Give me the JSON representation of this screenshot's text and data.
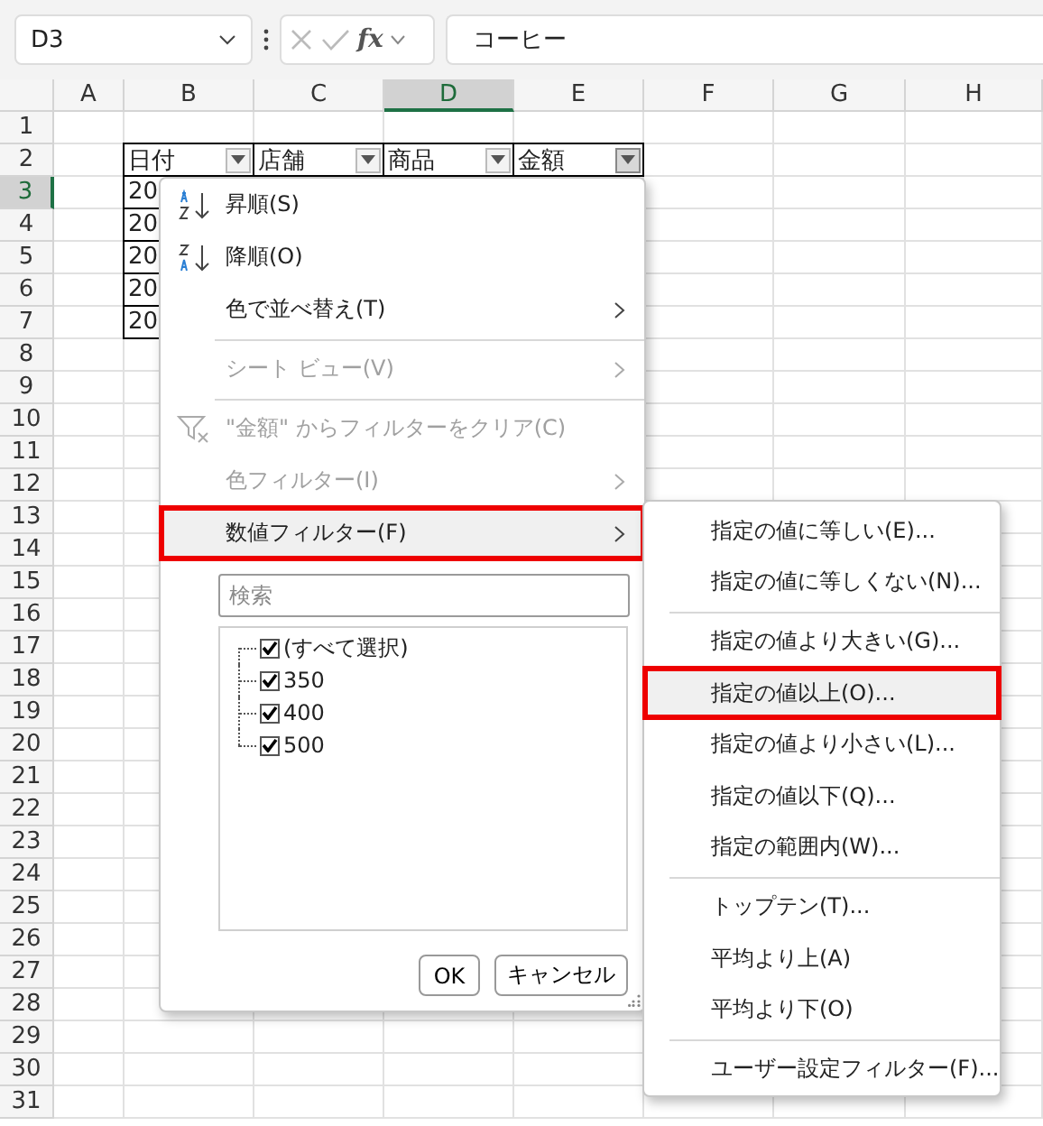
{
  "name_box": {
    "value": "D3"
  },
  "formula_bar": {
    "function_label": "fx",
    "value": "コーヒー"
  },
  "columns": [
    {
      "label": "A",
      "selected": false
    },
    {
      "label": "B",
      "selected": false
    },
    {
      "label": "C",
      "selected": false
    },
    {
      "label": "D",
      "selected": true
    },
    {
      "label": "E",
      "selected": false
    },
    {
      "label": "F",
      "selected": false
    },
    {
      "label": "G",
      "selected": false
    },
    {
      "label": "H",
      "selected": false
    }
  ],
  "rows": [
    {
      "label": "1",
      "selected": false
    },
    {
      "label": "2",
      "selected": false
    },
    {
      "label": "3",
      "selected": true
    },
    {
      "label": "4",
      "selected": false
    },
    {
      "label": "5",
      "selected": false
    },
    {
      "label": "6",
      "selected": false
    },
    {
      "label": "7",
      "selected": false
    },
    {
      "label": "8",
      "selected": false
    },
    {
      "label": "9",
      "selected": false
    },
    {
      "label": "10",
      "selected": false
    },
    {
      "label": "11",
      "selected": false
    },
    {
      "label": "12",
      "selected": false
    },
    {
      "label": "13",
      "selected": false
    },
    {
      "label": "14",
      "selected": false
    },
    {
      "label": "15",
      "selected": false
    },
    {
      "label": "16",
      "selected": false
    },
    {
      "label": "17",
      "selected": false
    },
    {
      "label": "18",
      "selected": false
    },
    {
      "label": "19",
      "selected": false
    },
    {
      "label": "20",
      "selected": false
    },
    {
      "label": "21",
      "selected": false
    },
    {
      "label": "22",
      "selected": false
    },
    {
      "label": "23",
      "selected": false
    },
    {
      "label": "24",
      "selected": false
    },
    {
      "label": "25",
      "selected": false
    },
    {
      "label": "26",
      "selected": false
    },
    {
      "label": "27",
      "selected": false
    },
    {
      "label": "28",
      "selected": false
    },
    {
      "label": "29",
      "selected": false
    },
    {
      "label": "30",
      "selected": false
    },
    {
      "label": "31",
      "selected": false
    }
  ],
  "table": {
    "headers": [
      {
        "text": "日付",
        "selected": false
      },
      {
        "text": "店舗",
        "selected": false
      },
      {
        "text": "商品",
        "selected": false
      },
      {
        "text": "金額",
        "selected": true
      }
    ],
    "rows": [
      "20",
      "20",
      "20",
      "20",
      "20"
    ]
  },
  "filter_menu": {
    "items": [
      {
        "kind": "sort_ascending",
        "label": "昇順(S)",
        "disabled": false,
        "submenu": false,
        "selected": false,
        "annotated": false
      },
      {
        "kind": "sort_descending",
        "label": "降順(O)",
        "disabled": false,
        "submenu": false,
        "selected": false,
        "annotated": false
      },
      {
        "kind": "item",
        "label": "色で並べ替え(T)",
        "disabled": false,
        "submenu": true,
        "selected": false,
        "annotated": false
      },
      {
        "kind": "separator"
      },
      {
        "kind": "item",
        "label": "シート ビュー(V)",
        "disabled": true,
        "submenu": true,
        "selected": false,
        "annotated": false
      },
      {
        "kind": "separator"
      },
      {
        "kind": "clear_filter",
        "label": "\"金額\" からフィルターをクリア(C)",
        "disabled": true,
        "submenu": false,
        "selected": false,
        "annotated": false
      },
      {
        "kind": "item",
        "label": "色フィルター(I)",
        "disabled": true,
        "submenu": true,
        "selected": false,
        "annotated": false
      },
      {
        "kind": "item",
        "label": "数値フィルター(F)",
        "disabled": false,
        "submenu": true,
        "selected": true,
        "annotated": true
      }
    ],
    "search": {
      "placeholder": "検索"
    },
    "values": [
      {
        "label": "(すべて選択)",
        "checked": true
      },
      {
        "label": "350",
        "checked": true
      },
      {
        "label": "400",
        "checked": true
      },
      {
        "label": "500",
        "checked": true
      }
    ],
    "buttons": [
      "OK",
      "キャンセル"
    ]
  },
  "number_filter_menu": {
    "items": [
      {
        "kind": "item",
        "label": "指定の値に等しい(E)...",
        "selected": false,
        "annotated": false
      },
      {
        "kind": "item",
        "label": "指定の値に等しくない(N)...",
        "selected": false,
        "annotated": false
      },
      {
        "kind": "separator"
      },
      {
        "kind": "item",
        "label": "指定の値より大きい(G)...",
        "selected": false,
        "annotated": false
      },
      {
        "kind": "item",
        "label": "指定の値以上(O)...",
        "selected": true,
        "annotated": true
      },
      {
        "kind": "item",
        "label": "指定の値より小さい(L)...",
        "selected": false,
        "annotated": false
      },
      {
        "kind": "item",
        "label": "指定の値以下(Q)...",
        "selected": false,
        "annotated": false
      },
      {
        "kind": "item",
        "label": "指定の範囲内(W)...",
        "selected": false,
        "annotated": false
      },
      {
        "kind": "separator"
      },
      {
        "kind": "item",
        "label": "トップテン(T)...",
        "selected": false,
        "annotated": false
      },
      {
        "kind": "item",
        "label": "平均より上(A)",
        "selected": false,
        "annotated": false
      },
      {
        "kind": "item",
        "label": "平均より下(O)",
        "selected": false,
        "annotated": false
      },
      {
        "kind": "separator"
      },
      {
        "kind": "item",
        "label": "ユーザー設定フィルター(F)...",
        "selected": false,
        "annotated": false
      }
    ]
  }
}
